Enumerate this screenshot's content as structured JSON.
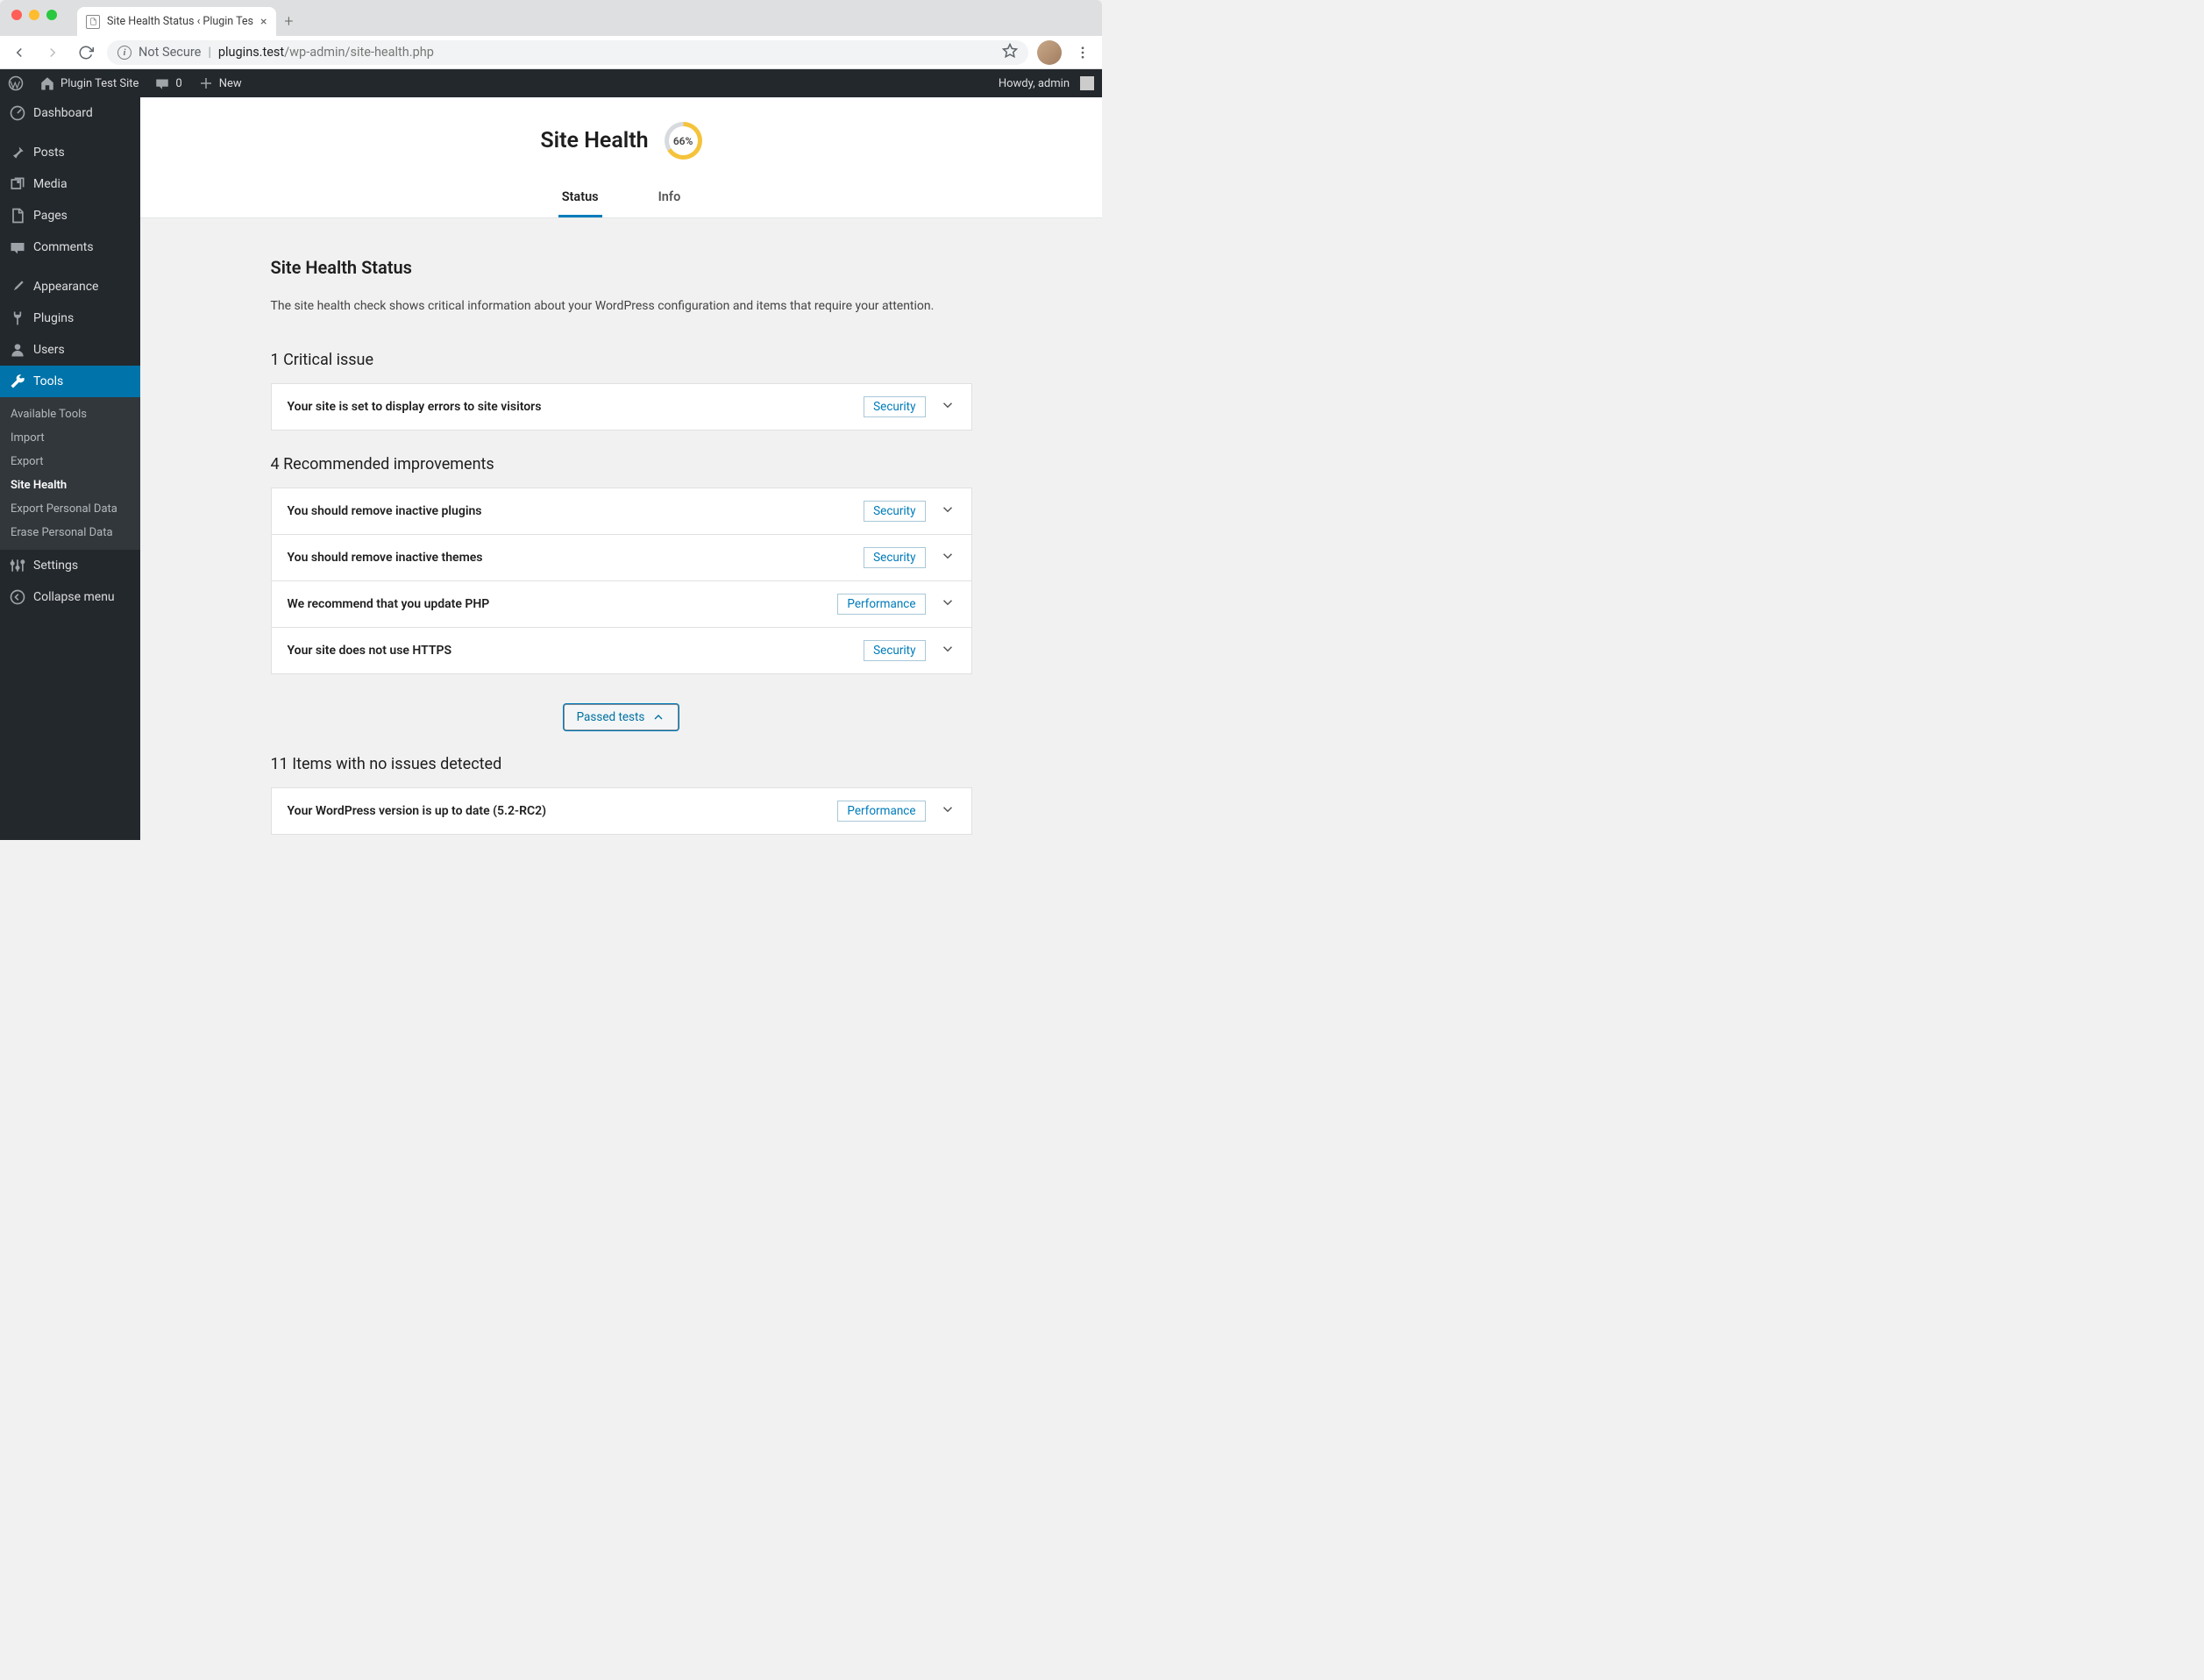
{
  "browser": {
    "tab_title": "Site Health Status ‹ Plugin Tes",
    "not_secure": "Not Secure",
    "url_host": "plugins.test",
    "url_path": "/wp-admin/site-health.php"
  },
  "adminbar": {
    "site_name": "Plugin Test Site",
    "comments": "0",
    "new_label": "New",
    "howdy": "Howdy, admin"
  },
  "sidebar": {
    "items": [
      {
        "label": "Dashboard",
        "icon": "dashboard"
      },
      {
        "label": "Posts",
        "icon": "pin"
      },
      {
        "label": "Media",
        "icon": "media"
      },
      {
        "label": "Pages",
        "icon": "page"
      },
      {
        "label": "Comments",
        "icon": "comment"
      },
      {
        "label": "Appearance",
        "icon": "brush"
      },
      {
        "label": "Plugins",
        "icon": "plug"
      },
      {
        "label": "Users",
        "icon": "user"
      },
      {
        "label": "Tools",
        "icon": "wrench"
      },
      {
        "label": "Settings",
        "icon": "sliders"
      },
      {
        "label": "Collapse menu",
        "icon": "collapse"
      }
    ],
    "tools_submenu": [
      {
        "label": "Available Tools"
      },
      {
        "label": "Import"
      },
      {
        "label": "Export"
      },
      {
        "label": "Site Health"
      },
      {
        "label": "Export Personal Data"
      },
      {
        "label": "Erase Personal Data"
      }
    ]
  },
  "site_health": {
    "title": "Site Health",
    "percent": "66%",
    "tab_status": "Status",
    "tab_info": "Info",
    "section_title": "Site Health Status",
    "description": "The site health check shows critical information about your WordPress configuration and items that require your attention.",
    "critical_heading": "1 Critical issue",
    "recommended_heading": "4 Recommended improvements",
    "passed_button": "Passed tests",
    "passed_heading": "11 Items with no issues detected",
    "critical": [
      {
        "title": "Your site is set to display errors to site visitors",
        "badge": "Security"
      }
    ],
    "recommended": [
      {
        "title": "You should remove inactive plugins",
        "badge": "Security"
      },
      {
        "title": "You should remove inactive themes",
        "badge": "Security"
      },
      {
        "title": "We recommend that you update PHP",
        "badge": "Performance"
      },
      {
        "title": "Your site does not use HTTPS",
        "badge": "Security"
      }
    ],
    "passed": [
      {
        "title": "Your WordPress version is up to date (5.2-RC2)",
        "badge": "Performance"
      }
    ]
  }
}
